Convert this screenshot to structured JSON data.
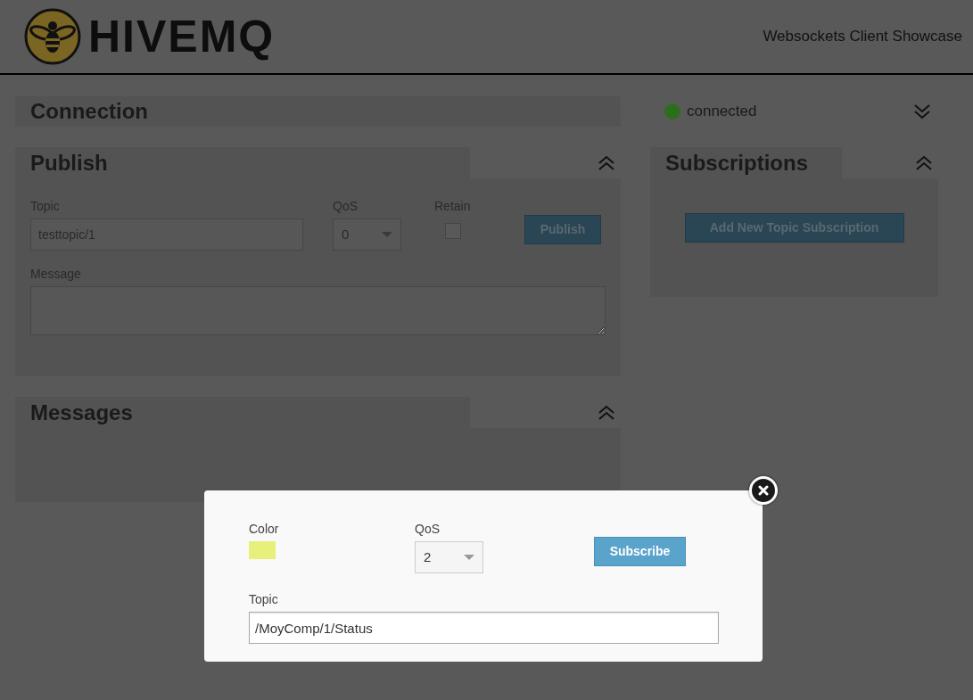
{
  "header": {
    "logo_text": "HIVEMQ",
    "subtitle": "Websockets Client Showcase"
  },
  "connection": {
    "title": "Connection",
    "expanded": false,
    "connected": true,
    "status": "connected"
  },
  "publish": {
    "title": "Publish",
    "expanded": true,
    "topic_label": "Topic",
    "topic_value": "testtopic/1",
    "qos_label": "QoS",
    "qos_value": "0",
    "retain_label": "Retain",
    "retain_checked": false,
    "message_label": "Message",
    "button": "Publish"
  },
  "subscriptions": {
    "title": "Subscriptions",
    "expanded": true,
    "button": "Add New Topic Subscription"
  },
  "messages": {
    "title": "Messages",
    "expanded": true
  },
  "dialog": {
    "color_label": "Color",
    "color": "#e6f07a",
    "qos_label": "QoS",
    "qos_value": "2",
    "button": "Subscribe",
    "topic_label": "Topic",
    "topic_value": "/MoyComp/1/Status"
  }
}
